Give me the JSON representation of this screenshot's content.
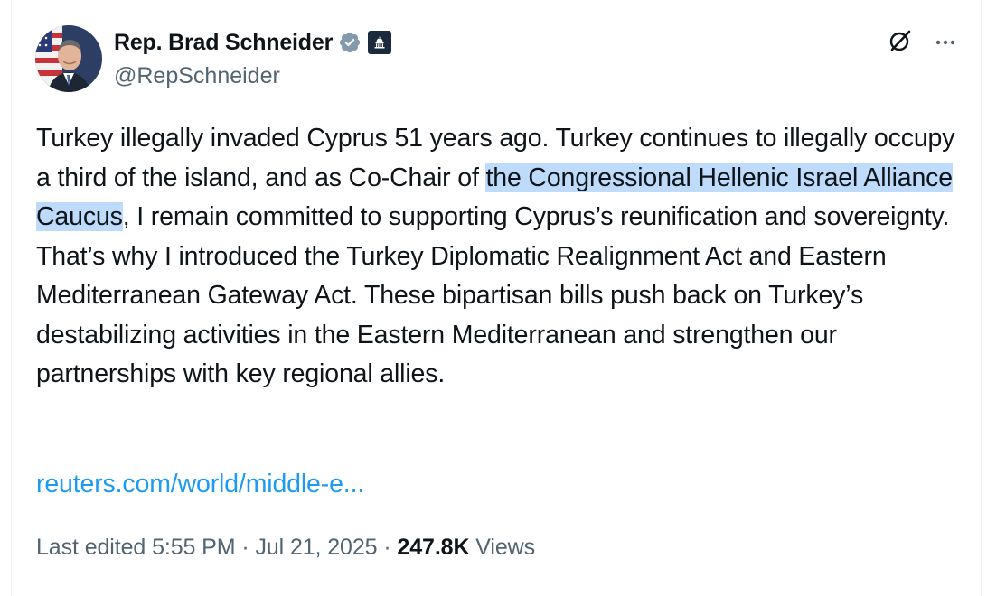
{
  "author": {
    "name": "Rep. Brad Schneider",
    "handle": "@RepSchneider"
  },
  "tweet": {
    "text_before_highlight": "Turkey illegally invaded Cyprus 51 years ago. Turkey continues to illegally occupy a third of the island, and as Co-Chair of ",
    "highlighted_text": "the Congressional Hellenic Israel Alliance Caucus",
    "text_after_highlight": ", I remain committed to supporting Cyprus’s reunification and sovereignty. That’s why I introduced the Turkey Diplomatic Realignment Act and Eastern Mediterranean Gateway Act. These bipartisan bills push back on Turkey’s destabilizing activities in the Eastern Mediterranean and strengthen our partnerships with key regional allies.",
    "link_text": "reuters.com/world/middle-e..."
  },
  "meta": {
    "edited_label": "Last edited",
    "time": "5:55 PM",
    "separator": "·",
    "date": "Jul 21, 2025",
    "views_count": "247.8K",
    "views_label": "Views"
  },
  "colors": {
    "link": "#1d9bf0",
    "highlight": "#bfdbfb",
    "secondary_text": "#536471",
    "primary_text": "#0f1419",
    "verified_badge": "#829aab",
    "gov_badge": "#1b2a3d"
  },
  "icons": [
    "verified-badge-icon",
    "government-badge-icon",
    "grok-icon",
    "more-options-icon"
  ]
}
